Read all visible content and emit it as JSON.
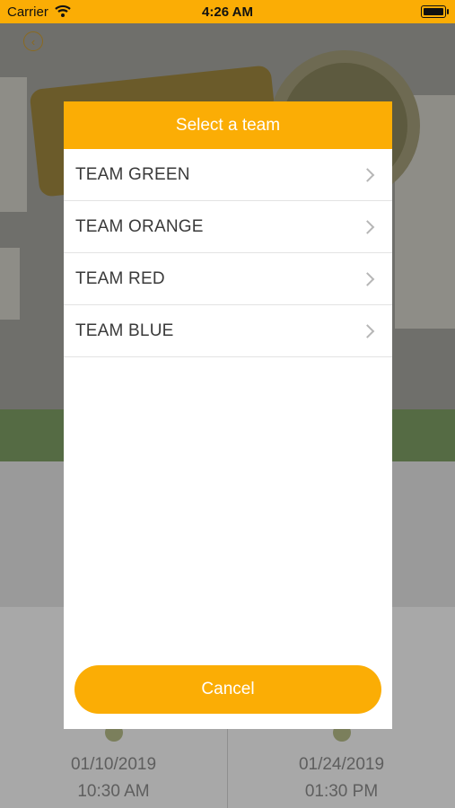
{
  "status_bar": {
    "carrier": "Carrier",
    "time": "4:26 AM"
  },
  "background": {
    "start": {
      "date": "01/10/2019",
      "time": "10:30 AM"
    },
    "end": {
      "date": "01/24/2019",
      "time": "01:30 PM"
    }
  },
  "modal": {
    "title": "Select a team",
    "teams": [
      {
        "label": "TEAM GREEN"
      },
      {
        "label": "TEAM ORANGE"
      },
      {
        "label": "TEAM RED"
      },
      {
        "label": "TEAM BLUE"
      }
    ],
    "cancel_label": "Cancel"
  },
  "colors": {
    "accent": "#fbad05",
    "overlay_dim": "#a9a9a9"
  },
  "icons": {
    "back": "chevron-left-circle-icon",
    "wifi": "wifi-icon",
    "battery": "battery-icon",
    "row_chevron": "chevron-right-icon",
    "start_clock": "clock-icon",
    "end_alarm": "alarm-icon"
  }
}
